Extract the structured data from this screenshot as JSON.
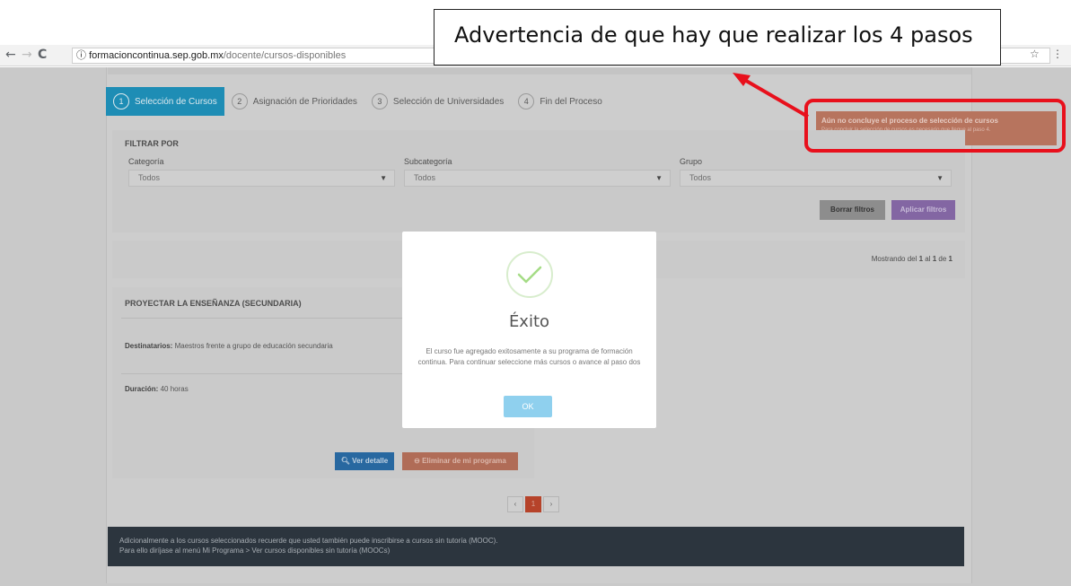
{
  "browser": {
    "back": "←",
    "forward": "→",
    "reload": "C",
    "info_icon": "ⓘ",
    "url_host": "formacioncontinua.sep.gob.mx",
    "url_path": "/docente/cursos-disponibles"
  },
  "steps": [
    {
      "num": "1",
      "label": "Selección de Cursos",
      "active": true
    },
    {
      "num": "2",
      "label": "Asignación de Prioridades",
      "active": false
    },
    {
      "num": "3",
      "label": "Selección de Universidades",
      "active": false
    },
    {
      "num": "4",
      "label": "Fin del Proceso",
      "active": false
    }
  ],
  "alert": {
    "title": "Aún no concluye el proceso de selección de cursos",
    "detail": "Para concluir la selección de cursos es necesario que llegue al paso 4."
  },
  "filters": {
    "title": "FILTRAR POR",
    "category_label": "Categoría",
    "category_value": "Todos",
    "subcategory_label": "Subcategoría",
    "subcategory_value": "Todos",
    "group_label": "Grupo",
    "group_value": "Todos",
    "clear_label": "Borrar filtros",
    "apply_label": "Aplicar filtros"
  },
  "results": {
    "prefix": "Mostrando del ",
    "from": "1",
    "mid": " al ",
    "to": "1",
    "of": " de ",
    "total": "1"
  },
  "course": {
    "title": "PROYECTAR LA ENSEÑANZA (SECUNDARIA)",
    "dest_label": "Destinatarios:",
    "dest_value": " Maestros frente a grupo de educación secundaria",
    "dur_label": "Duración:",
    "dur_value": " 40 horas",
    "view_label": "Ver detalle",
    "delete_label": "Eliminar de mi programa"
  },
  "pager": {
    "prev": "‹",
    "current": "1",
    "next": "›"
  },
  "info": {
    "line1": "Adicionalmente a los cursos seleccionados recuerde que usted también puede inscribirse a cursos sin tutoría (MOOC).",
    "line2": "Para ello diríjase al menú Mi Programa > Ver cursos disponibles sin tutoría (MOOCs)"
  },
  "modal": {
    "title": "Éxito",
    "message": "El curso fue agregado exitosamente a su programa de formación continua. Para continuar seleccione más cursos o avance al paso dos",
    "ok_label": "OK",
    "icon": "check-icon"
  },
  "annotation": {
    "text": "Advertencia de que hay que realizar los 4 pasos"
  },
  "colors": {
    "step_active": "#1e8db5",
    "alert": "#b7745e",
    "highlight": "#e8101c",
    "ok_button": "#8fd0ee"
  }
}
